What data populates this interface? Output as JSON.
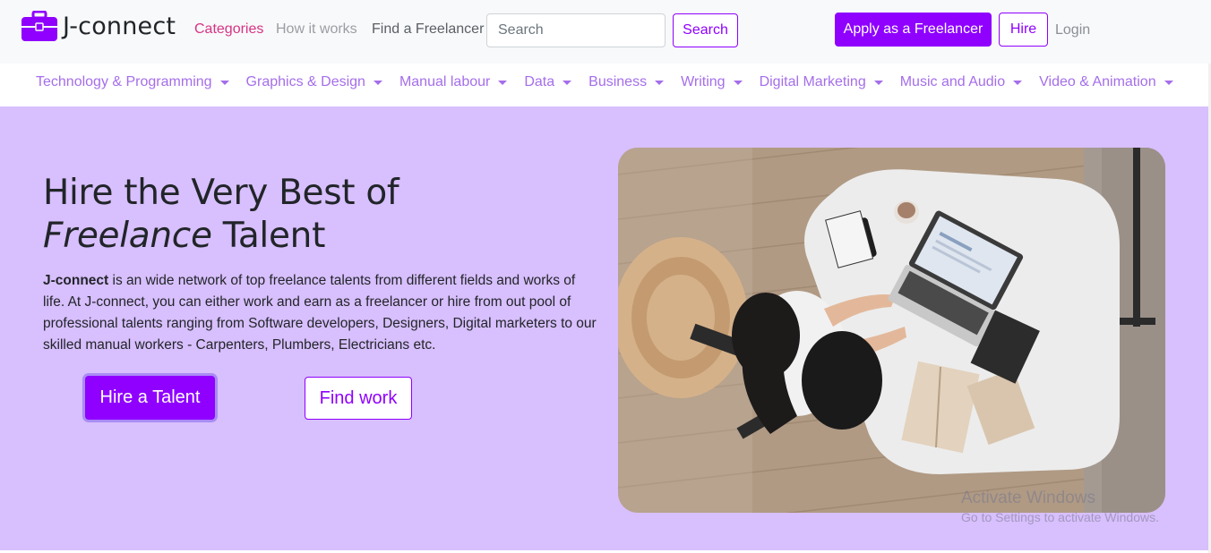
{
  "brand": {
    "name": "J-connect",
    "icon": "briefcase-icon",
    "color": "#8f00ff"
  },
  "nav": {
    "categories": "Categories",
    "how_it_works": "How it works",
    "find_freelancer": "Find a Freelancer",
    "search_placeholder": "Search",
    "search_button": "Search",
    "apply_button": "Apply as a Freelancer",
    "hire_button": "Hire",
    "login": "Login"
  },
  "categories": [
    {
      "label": "Technology & Programming"
    },
    {
      "label": "Graphics & Design"
    },
    {
      "label": "Manual labour"
    },
    {
      "label": "Data"
    },
    {
      "label": "Business"
    },
    {
      "label": "Writing"
    },
    {
      "label": "Digital Marketing"
    },
    {
      "label": "Music and Audio"
    },
    {
      "label": "Video & Animation"
    }
  ],
  "hero": {
    "title_line1": "Hire the Very Best of",
    "title_em": "Freelance",
    "title_rest": " Talent",
    "desc_strong": "J-connect",
    "desc_text": " is an wide network of top freelance talents from different fields and works of life. At J-connect, you can either work and earn as a freelancer or hire from out pool of professional talents ranging from Software developers, Designers, Digital marketers to our skilled manual workers - Carpenters, Plumbers, Electricians etc.",
    "primary_button": "Hire a Talent",
    "secondary_button": "Find work"
  },
  "watermark": {
    "title": "Activate Windows",
    "subtitle": "Go to Settings to activate Windows."
  },
  "colors": {
    "accent": "#8f00ff",
    "hero_bg": "#d8bffd",
    "category_text": "#a56eea",
    "categories_link": "#d63384"
  }
}
